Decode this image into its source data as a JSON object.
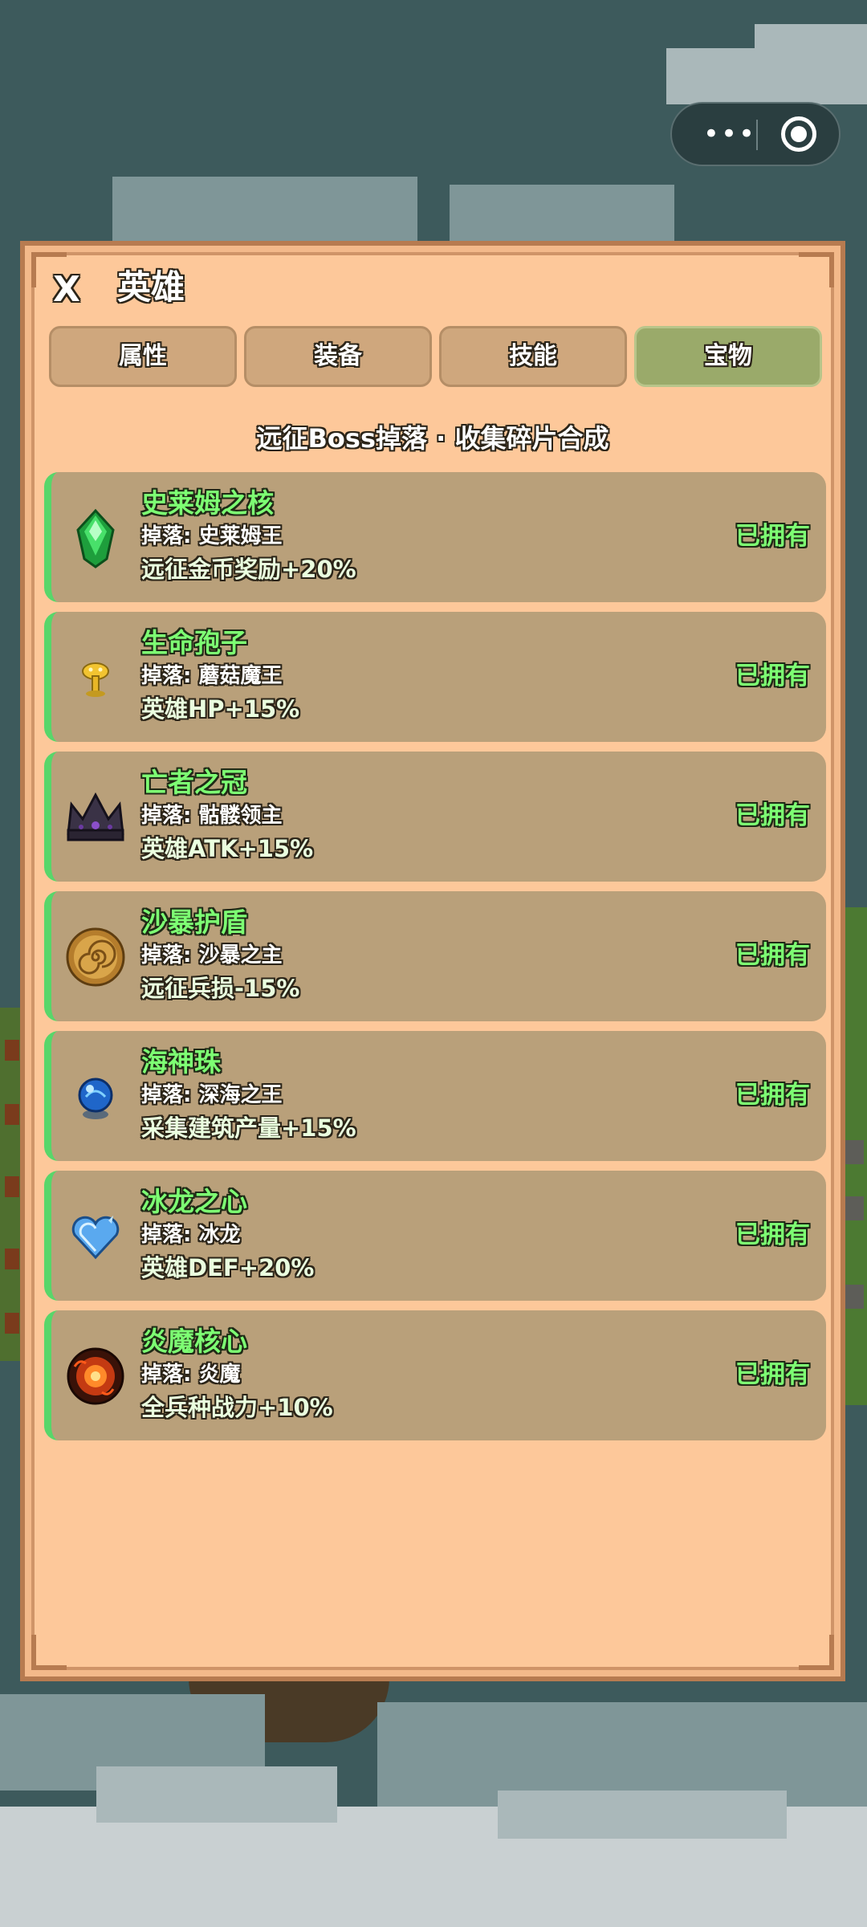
{
  "panel": {
    "close_label": "X",
    "title": "英雄",
    "subtitle": "远征Boss掉落 · 收集碎片合成"
  },
  "tabs": [
    {
      "label": "属性",
      "active": false
    },
    {
      "label": "装备",
      "active": false
    },
    {
      "label": "技能",
      "active": false
    },
    {
      "label": "宝物",
      "active": true
    }
  ],
  "treasures": [
    {
      "name": "史莱姆之核",
      "drop": "掉落: 史莱姆王",
      "bonus": "远征金币奖励+20%",
      "status": "已拥有",
      "icon": "green-gem-icon"
    },
    {
      "name": "生命孢子",
      "drop": "掉落: 蘑菇魔王",
      "bonus": "英雄HP+15%",
      "status": "已拥有",
      "icon": "golden-mushroom-icon"
    },
    {
      "name": "亡者之冠",
      "drop": "掉落: 骷髅领主",
      "bonus": "英雄ATK+15%",
      "status": "已拥有",
      "icon": "dark-crown-icon"
    },
    {
      "name": "沙暴护盾",
      "drop": "掉落: 沙暴之主",
      "bonus": "远征兵损-15%",
      "status": "已拥有",
      "icon": "spiral-shield-icon"
    },
    {
      "name": "海神珠",
      "drop": "掉落: 深海之王",
      "bonus": "采集建筑产量+15%",
      "status": "已拥有",
      "icon": "blue-orb-icon"
    },
    {
      "name": "冰龙之心",
      "drop": "掉落: 冰龙",
      "bonus": "英雄DEF+20%",
      "status": "已拥有",
      "icon": "ice-heart-icon"
    },
    {
      "name": "炎魔核心",
      "drop": "掉落: 炎魔",
      "bonus": "全兵种战力+10%",
      "status": "已拥有",
      "icon": "fire-core-icon"
    }
  ],
  "colors": {
    "panel_bg": "#fdc89a",
    "card_bg": "#b9a07a",
    "active_tab": "#9aaa6a",
    "owned_green": "#7dff73"
  }
}
